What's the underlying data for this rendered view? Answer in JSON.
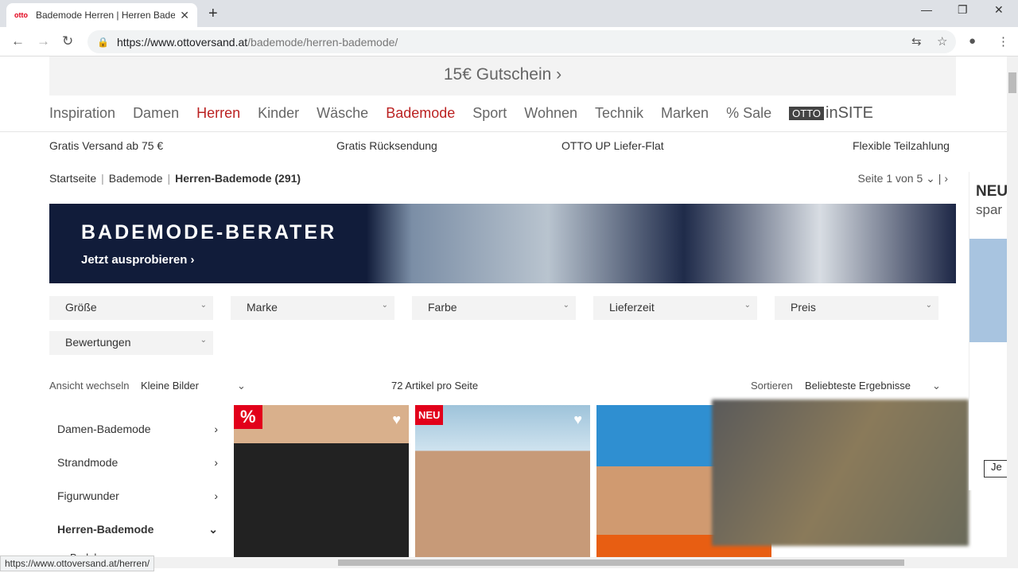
{
  "browser": {
    "tab_title": "Bademode Herren | Herren Bade",
    "tab_favicon": "otto",
    "url_host": "https://www.ottoversand.at",
    "url_path": "/bademode/herren-bademode/",
    "status_url": "https://www.ottoversand.at/herren/"
  },
  "promo": {
    "text": "15€ Gutschein ›"
  },
  "nav": {
    "items": [
      {
        "label": "Inspiration"
      },
      {
        "label": "Damen"
      },
      {
        "label": "Herren"
      },
      {
        "label": "Kinder"
      },
      {
        "label": "Wäsche"
      },
      {
        "label": "Bademode"
      },
      {
        "label": "Sport"
      },
      {
        "label": "Wohnen"
      },
      {
        "label": "Technik"
      },
      {
        "label": "Marken"
      },
      {
        "label": "% Sale"
      }
    ],
    "logo_a": "OTTO",
    "logo_b": "inSITE"
  },
  "usp": [
    "Gratis Versand ab 75 €",
    "Gratis Rücksendung",
    "OTTO UP Liefer-Flat",
    "Flexible Teilzahlung"
  ],
  "breadcrumb": {
    "items": [
      "Startseite",
      "Bademode",
      "Herren-Bademode (291)"
    ]
  },
  "pager": {
    "label": "Seite",
    "value": "1 von 5",
    "next": "›"
  },
  "banner": {
    "title": "BADEMODE-BERATER",
    "cta": "Jetzt ausprobieren ›"
  },
  "filters": [
    "Größe",
    "Marke",
    "Farbe",
    "Lieferzeit",
    "Preis",
    "Bewertungen"
  ],
  "view": {
    "label": "Ansicht wechseln",
    "value": "Kleine Bilder",
    "per_page": "72 Artikel pro Seite",
    "sort_label": "Sortieren",
    "sort_value": "Beliebteste Ergebnisse"
  },
  "sidebar": {
    "items": [
      {
        "label": "Damen-Bademode",
        "arrow": "›"
      },
      {
        "label": "Strandmode",
        "arrow": "›"
      },
      {
        "label": "Figurwunder",
        "arrow": "›"
      },
      {
        "label": "Herren-Bademode",
        "arrow": "⌄"
      }
    ],
    "sub": [
      "Badehosen"
    ]
  },
  "products": [
    {
      "badge": "%"
    },
    {
      "badge": "NEU"
    },
    {
      "badge": ""
    }
  ],
  "side_ad": {
    "title": "NEU",
    "sub": "spar",
    "button": "Je"
  },
  "colors": {
    "accent": "#e2001a",
    "active_nav": "#bb2222"
  }
}
